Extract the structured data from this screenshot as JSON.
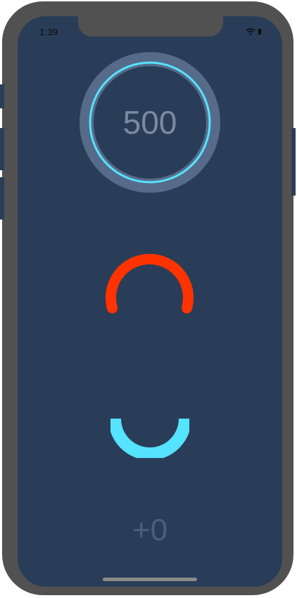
{
  "status_bar": {
    "time": "1:39",
    "wifi_icon": "wifi-icon",
    "battery_icon": "battery-icon"
  },
  "game": {
    "score": "500",
    "bonus": "+0",
    "ring_colors": {
      "outer_track": "#566b8a",
      "accent": "#57e2ff"
    },
    "red_arc_color": "#ff3300",
    "cyan_bowl_color": "#55e3ff"
  }
}
